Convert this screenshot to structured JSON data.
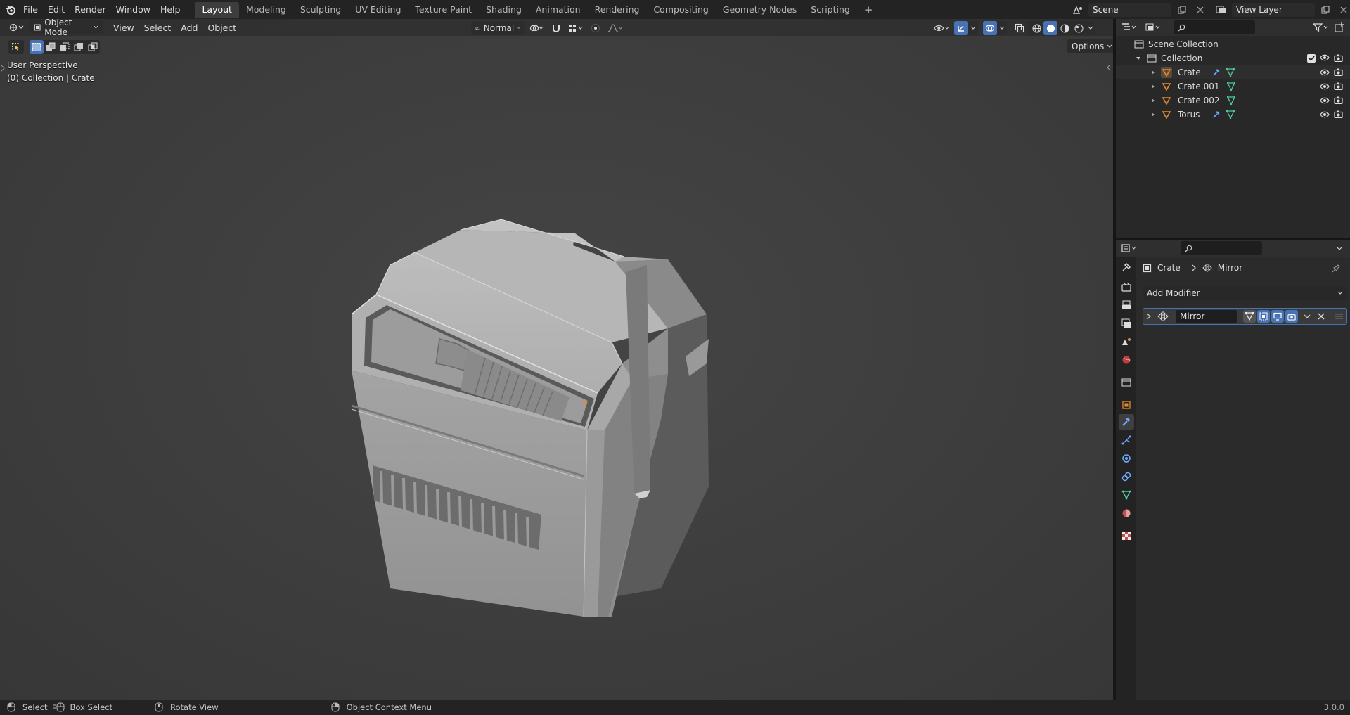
{
  "topbar": {
    "menus": [
      "File",
      "Edit",
      "Render",
      "Window",
      "Help"
    ],
    "workspaces": [
      "Layout",
      "Modeling",
      "Sculpting",
      "UV Editing",
      "Texture Paint",
      "Shading",
      "Animation",
      "Rendering",
      "Compositing",
      "Geometry Nodes",
      "Scripting"
    ],
    "add_workspace": "+",
    "scene": "Scene",
    "view_layer": "View Layer"
  },
  "viewport": {
    "mode": "Object Mode",
    "menus": [
      "View",
      "Select",
      "Add",
      "Object"
    ],
    "orientation": "Normal",
    "options": "Options",
    "perspective": "User Perspective",
    "context": "(0) Collection | Crate"
  },
  "outliner": {
    "scene_collection": "Scene Collection",
    "collection": "Collection",
    "items": [
      "Crate",
      "Crate.001",
      "Crate.002",
      "Torus"
    ]
  },
  "properties": {
    "breadcrumb_object": "Crate",
    "breadcrumb_modifier": "Mirror",
    "add_modifier": "Add Modifier",
    "modifier_name": "Mirror"
  },
  "statusbar": {
    "select": "Select",
    "box_select": "Box Select",
    "rotate_view": "Rotate View",
    "context_menu": "Object Context Menu",
    "version": "3.0.0"
  },
  "colors": {
    "accent": "#4772b3",
    "object_orange": "#e8892c",
    "mesh_green": "#4fc9a0",
    "modifier_blue": "#6fa8ff"
  }
}
